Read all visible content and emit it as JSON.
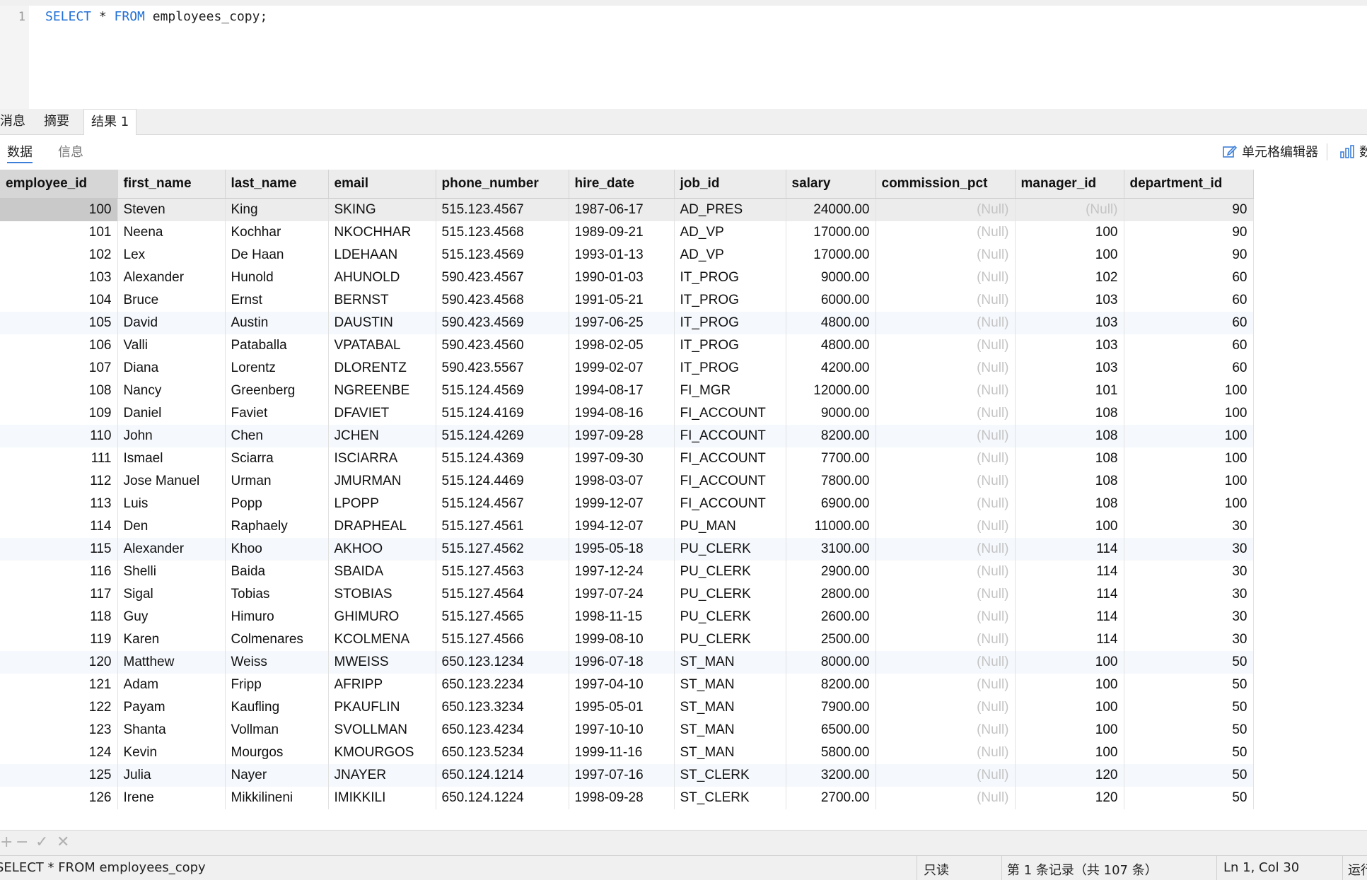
{
  "editor": {
    "line_number": "1",
    "keyword_select": "SELECT",
    "star": " * ",
    "keyword_from": "FROM",
    "rest": " employees_copy;"
  },
  "result_tabs": [
    "消息",
    "摘要",
    "结果 1"
  ],
  "sub_tabs": [
    "数据",
    "信息"
  ],
  "toolbar": {
    "cell_editor": "单元格编辑器",
    "data_partial": "数"
  },
  "table": {
    "columns": [
      "employee_id",
      "first_name",
      "last_name",
      "email",
      "phone_number",
      "hire_date",
      "job_id",
      "salary",
      "commission_pct",
      "manager_id",
      "department_id"
    ],
    "null_text": "(Null)",
    "rows": [
      [
        "100",
        "Steven",
        "King",
        "SKING",
        "515.123.4567",
        "1987-06-17",
        "AD_PRES",
        "24000.00",
        "(Null)",
        "(Null)",
        "90"
      ],
      [
        "101",
        "Neena",
        "Kochhar",
        "NKOCHHAR",
        "515.123.4568",
        "1989-09-21",
        "AD_VP",
        "17000.00",
        "(Null)",
        "100",
        "90"
      ],
      [
        "102",
        "Lex",
        "De Haan",
        "LDEHAAN",
        "515.123.4569",
        "1993-01-13",
        "AD_VP",
        "17000.00",
        "(Null)",
        "100",
        "90"
      ],
      [
        "103",
        "Alexander",
        "Hunold",
        "AHUNOLD",
        "590.423.4567",
        "1990-01-03",
        "IT_PROG",
        "9000.00",
        "(Null)",
        "102",
        "60"
      ],
      [
        "104",
        "Bruce",
        "Ernst",
        "BERNST",
        "590.423.4568",
        "1991-05-21",
        "IT_PROG",
        "6000.00",
        "(Null)",
        "103",
        "60"
      ],
      [
        "105",
        "David",
        "Austin",
        "DAUSTIN",
        "590.423.4569",
        "1997-06-25",
        "IT_PROG",
        "4800.00",
        "(Null)",
        "103",
        "60"
      ],
      [
        "106",
        "Valli",
        "Pataballa",
        "VPATABAL",
        "590.423.4560",
        "1998-02-05",
        "IT_PROG",
        "4800.00",
        "(Null)",
        "103",
        "60"
      ],
      [
        "107",
        "Diana",
        "Lorentz",
        "DLORENTZ",
        "590.423.5567",
        "1999-02-07",
        "IT_PROG",
        "4200.00",
        "(Null)",
        "103",
        "60"
      ],
      [
        "108",
        "Nancy",
        "Greenberg",
        "NGREENBE",
        "515.124.4569",
        "1994-08-17",
        "FI_MGR",
        "12000.00",
        "(Null)",
        "101",
        "100"
      ],
      [
        "109",
        "Daniel",
        "Faviet",
        "DFAVIET",
        "515.124.4169",
        "1994-08-16",
        "FI_ACCOUNT",
        "9000.00",
        "(Null)",
        "108",
        "100"
      ],
      [
        "110",
        "John",
        "Chen",
        "JCHEN",
        "515.124.4269",
        "1997-09-28",
        "FI_ACCOUNT",
        "8200.00",
        "(Null)",
        "108",
        "100"
      ],
      [
        "111",
        "Ismael",
        "Sciarra",
        "ISCIARRA",
        "515.124.4369",
        "1997-09-30",
        "FI_ACCOUNT",
        "7700.00",
        "(Null)",
        "108",
        "100"
      ],
      [
        "112",
        "Jose Manuel",
        "Urman",
        "JMURMAN",
        "515.124.4469",
        "1998-03-07",
        "FI_ACCOUNT",
        "7800.00",
        "(Null)",
        "108",
        "100"
      ],
      [
        "113",
        "Luis",
        "Popp",
        "LPOPP",
        "515.124.4567",
        "1999-12-07",
        "FI_ACCOUNT",
        "6900.00",
        "(Null)",
        "108",
        "100"
      ],
      [
        "114",
        "Den",
        "Raphaely",
        "DRAPHEAL",
        "515.127.4561",
        "1994-12-07",
        "PU_MAN",
        "11000.00",
        "(Null)",
        "100",
        "30"
      ],
      [
        "115",
        "Alexander",
        "Khoo",
        "AKHOO",
        "515.127.4562",
        "1995-05-18",
        "PU_CLERK",
        "3100.00",
        "(Null)",
        "114",
        "30"
      ],
      [
        "116",
        "Shelli",
        "Baida",
        "SBAIDA",
        "515.127.4563",
        "1997-12-24",
        "PU_CLERK",
        "2900.00",
        "(Null)",
        "114",
        "30"
      ],
      [
        "117",
        "Sigal",
        "Tobias",
        "STOBIAS",
        "515.127.4564",
        "1997-07-24",
        "PU_CLERK",
        "2800.00",
        "(Null)",
        "114",
        "30"
      ],
      [
        "118",
        "Guy",
        "Himuro",
        "GHIMURO",
        "515.127.4565",
        "1998-11-15",
        "PU_CLERK",
        "2600.00",
        "(Null)",
        "114",
        "30"
      ],
      [
        "119",
        "Karen",
        "Colmenares",
        "KCOLMENA",
        "515.127.4566",
        "1999-08-10",
        "PU_CLERK",
        "2500.00",
        "(Null)",
        "114",
        "30"
      ],
      [
        "120",
        "Matthew",
        "Weiss",
        "MWEISS",
        "650.123.1234",
        "1996-07-18",
        "ST_MAN",
        "8000.00",
        "(Null)",
        "100",
        "50"
      ],
      [
        "121",
        "Adam",
        "Fripp",
        "AFRIPP",
        "650.123.2234",
        "1997-04-10",
        "ST_MAN",
        "8200.00",
        "(Null)",
        "100",
        "50"
      ],
      [
        "122",
        "Payam",
        "Kaufling",
        "PKAUFLIN",
        "650.123.3234",
        "1995-05-01",
        "ST_MAN",
        "7900.00",
        "(Null)",
        "100",
        "50"
      ],
      [
        "123",
        "Shanta",
        "Vollman",
        "SVOLLMAN",
        "650.123.4234",
        "1997-10-10",
        "ST_MAN",
        "6500.00",
        "(Null)",
        "100",
        "50"
      ],
      [
        "124",
        "Kevin",
        "Mourgos",
        "KMOURGOS",
        "650.123.5234",
        "1999-11-16",
        "ST_MAN",
        "5800.00",
        "(Null)",
        "100",
        "50"
      ],
      [
        "125",
        "Julia",
        "Nayer",
        "JNAYER",
        "650.124.1214",
        "1997-07-16",
        "ST_CLERK",
        "3200.00",
        "(Null)",
        "120",
        "50"
      ],
      [
        "126",
        "Irene",
        "Mikkilineni",
        "IMIKKILI",
        "650.124.1224",
        "1998-09-28",
        "ST_CLERK",
        "2700.00",
        "(Null)",
        "120",
        "50"
      ]
    ]
  },
  "grid_tools": [
    "+",
    "−",
    "✓",
    "✕"
  ],
  "status": {
    "sql": "SELECT * FROM employees_copy",
    "mode": "只读",
    "records": "第 1 条记录（共 107 条）",
    "position": "Ln 1, Col 30",
    "run_partial": "运行"
  }
}
